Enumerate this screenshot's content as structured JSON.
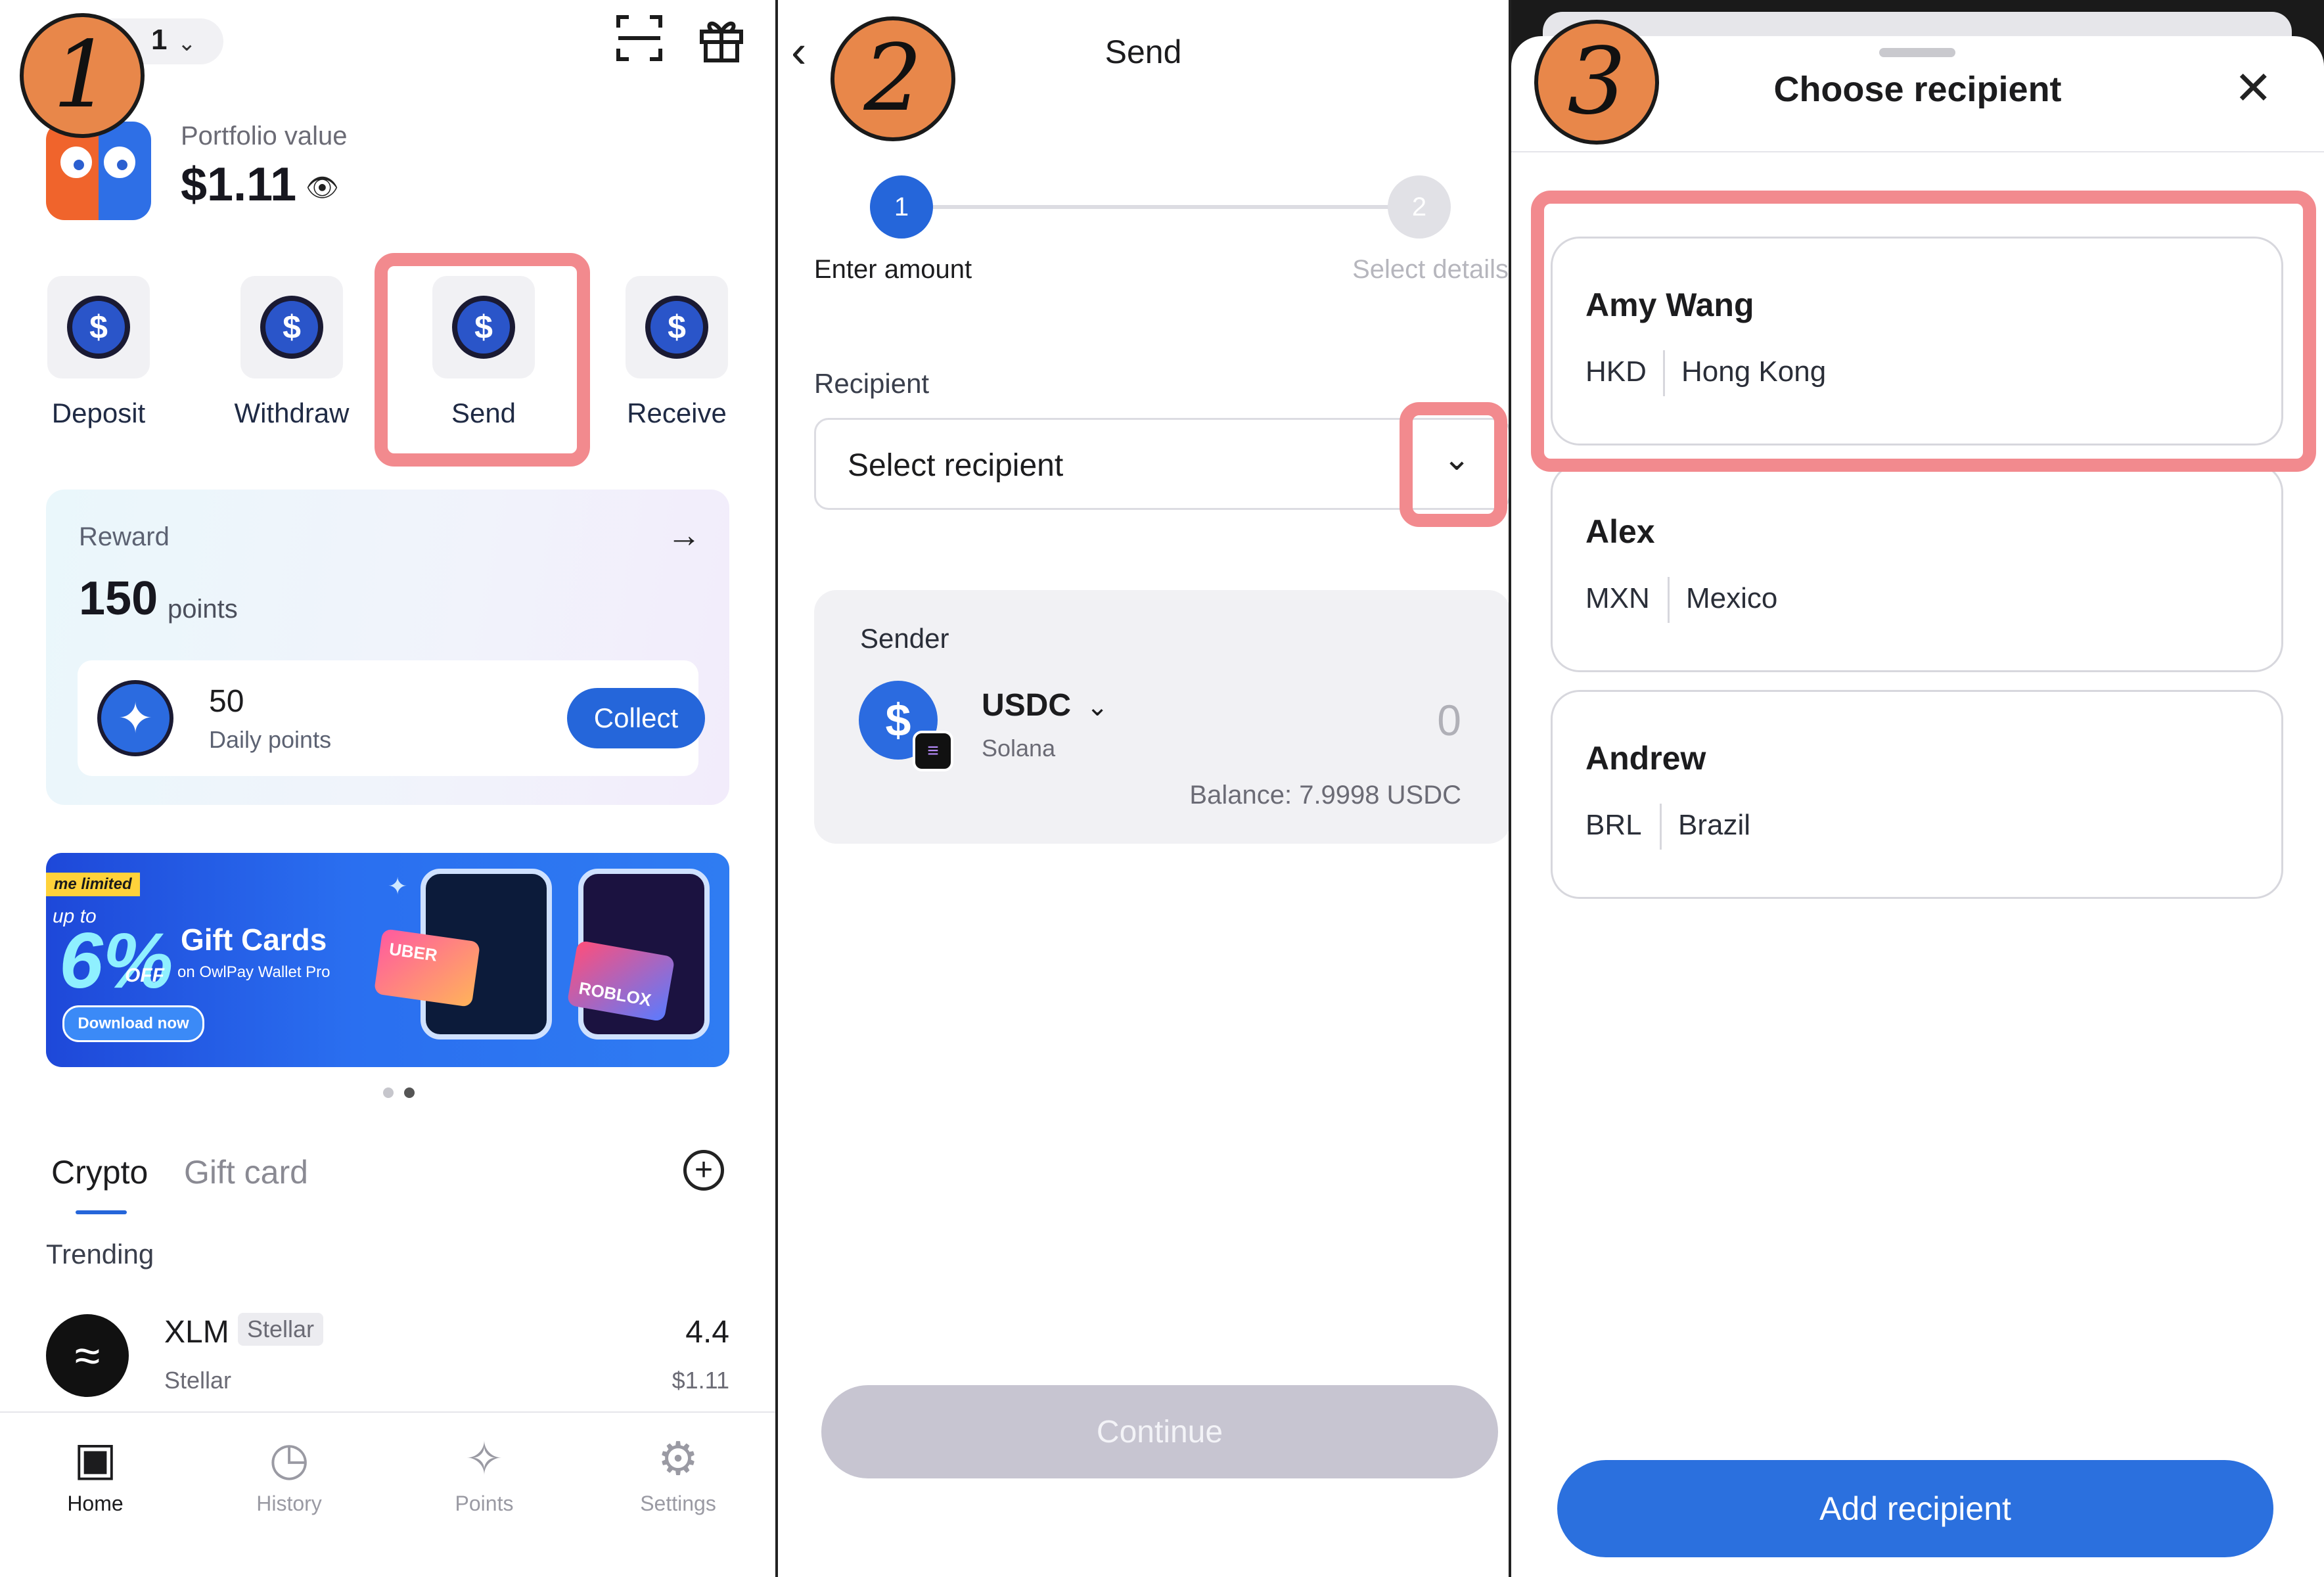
{
  "steps": [
    "1",
    "2",
    "3"
  ],
  "home": {
    "account_label": "1",
    "scan_icon": "scan-icon",
    "gift_icon": "gift-icon",
    "portfolio_label": "Portfolio value",
    "portfolio_value": "$1.11",
    "actions": [
      "Deposit",
      "Withdraw",
      "Send",
      "Receive"
    ],
    "reward": {
      "title": "Reward",
      "points": "150",
      "points_unit": "points",
      "daily_points": "50",
      "daily_label": "Daily points",
      "collect_label": "Collect"
    },
    "banner": {
      "tag": "me limited",
      "up_to": "up to",
      "percent": "6%",
      "off": "OFF",
      "title": "Gift Cards",
      "subtitle": "on OwlPay Wallet Pro",
      "cta": "Download now",
      "card1": "UBER",
      "card2": "ROBLOX"
    },
    "tabs": [
      "Crypto",
      "Gift card"
    ],
    "trending_label": "Trending",
    "asset": {
      "symbol": "XLM",
      "tag": "Stellar",
      "name": "Stellar",
      "amount": "4.4",
      "value": "$1.11"
    },
    "nav": [
      "Home",
      "History",
      "Points",
      "Settings"
    ]
  },
  "send": {
    "title": "Send",
    "step1": "1",
    "step2": "2",
    "step1_label": "Enter amount",
    "step2_label": "Select details",
    "recipient_label": "Recipient",
    "recipient_placeholder": "Select recipient",
    "sender_title": "Sender",
    "token_symbol": "USDC",
    "token_network": "Solana",
    "amount": "0",
    "balance": "Balance: 7.9998 USDC",
    "continue_label": "Continue"
  },
  "choose": {
    "title": "Choose recipient",
    "recipients": [
      {
        "name": "Amy Wang",
        "currency": "HKD",
        "country": "Hong Kong"
      },
      {
        "name": "Alex",
        "currency": "MXN",
        "country": "Mexico"
      },
      {
        "name": "Andrew",
        "currency": "BRL",
        "country": "Brazil"
      }
    ],
    "add_label": "Add recipient"
  },
  "colors": {
    "accent": "#2566da",
    "highlight": "#f28a8e",
    "step_badge": "#e8874a"
  }
}
